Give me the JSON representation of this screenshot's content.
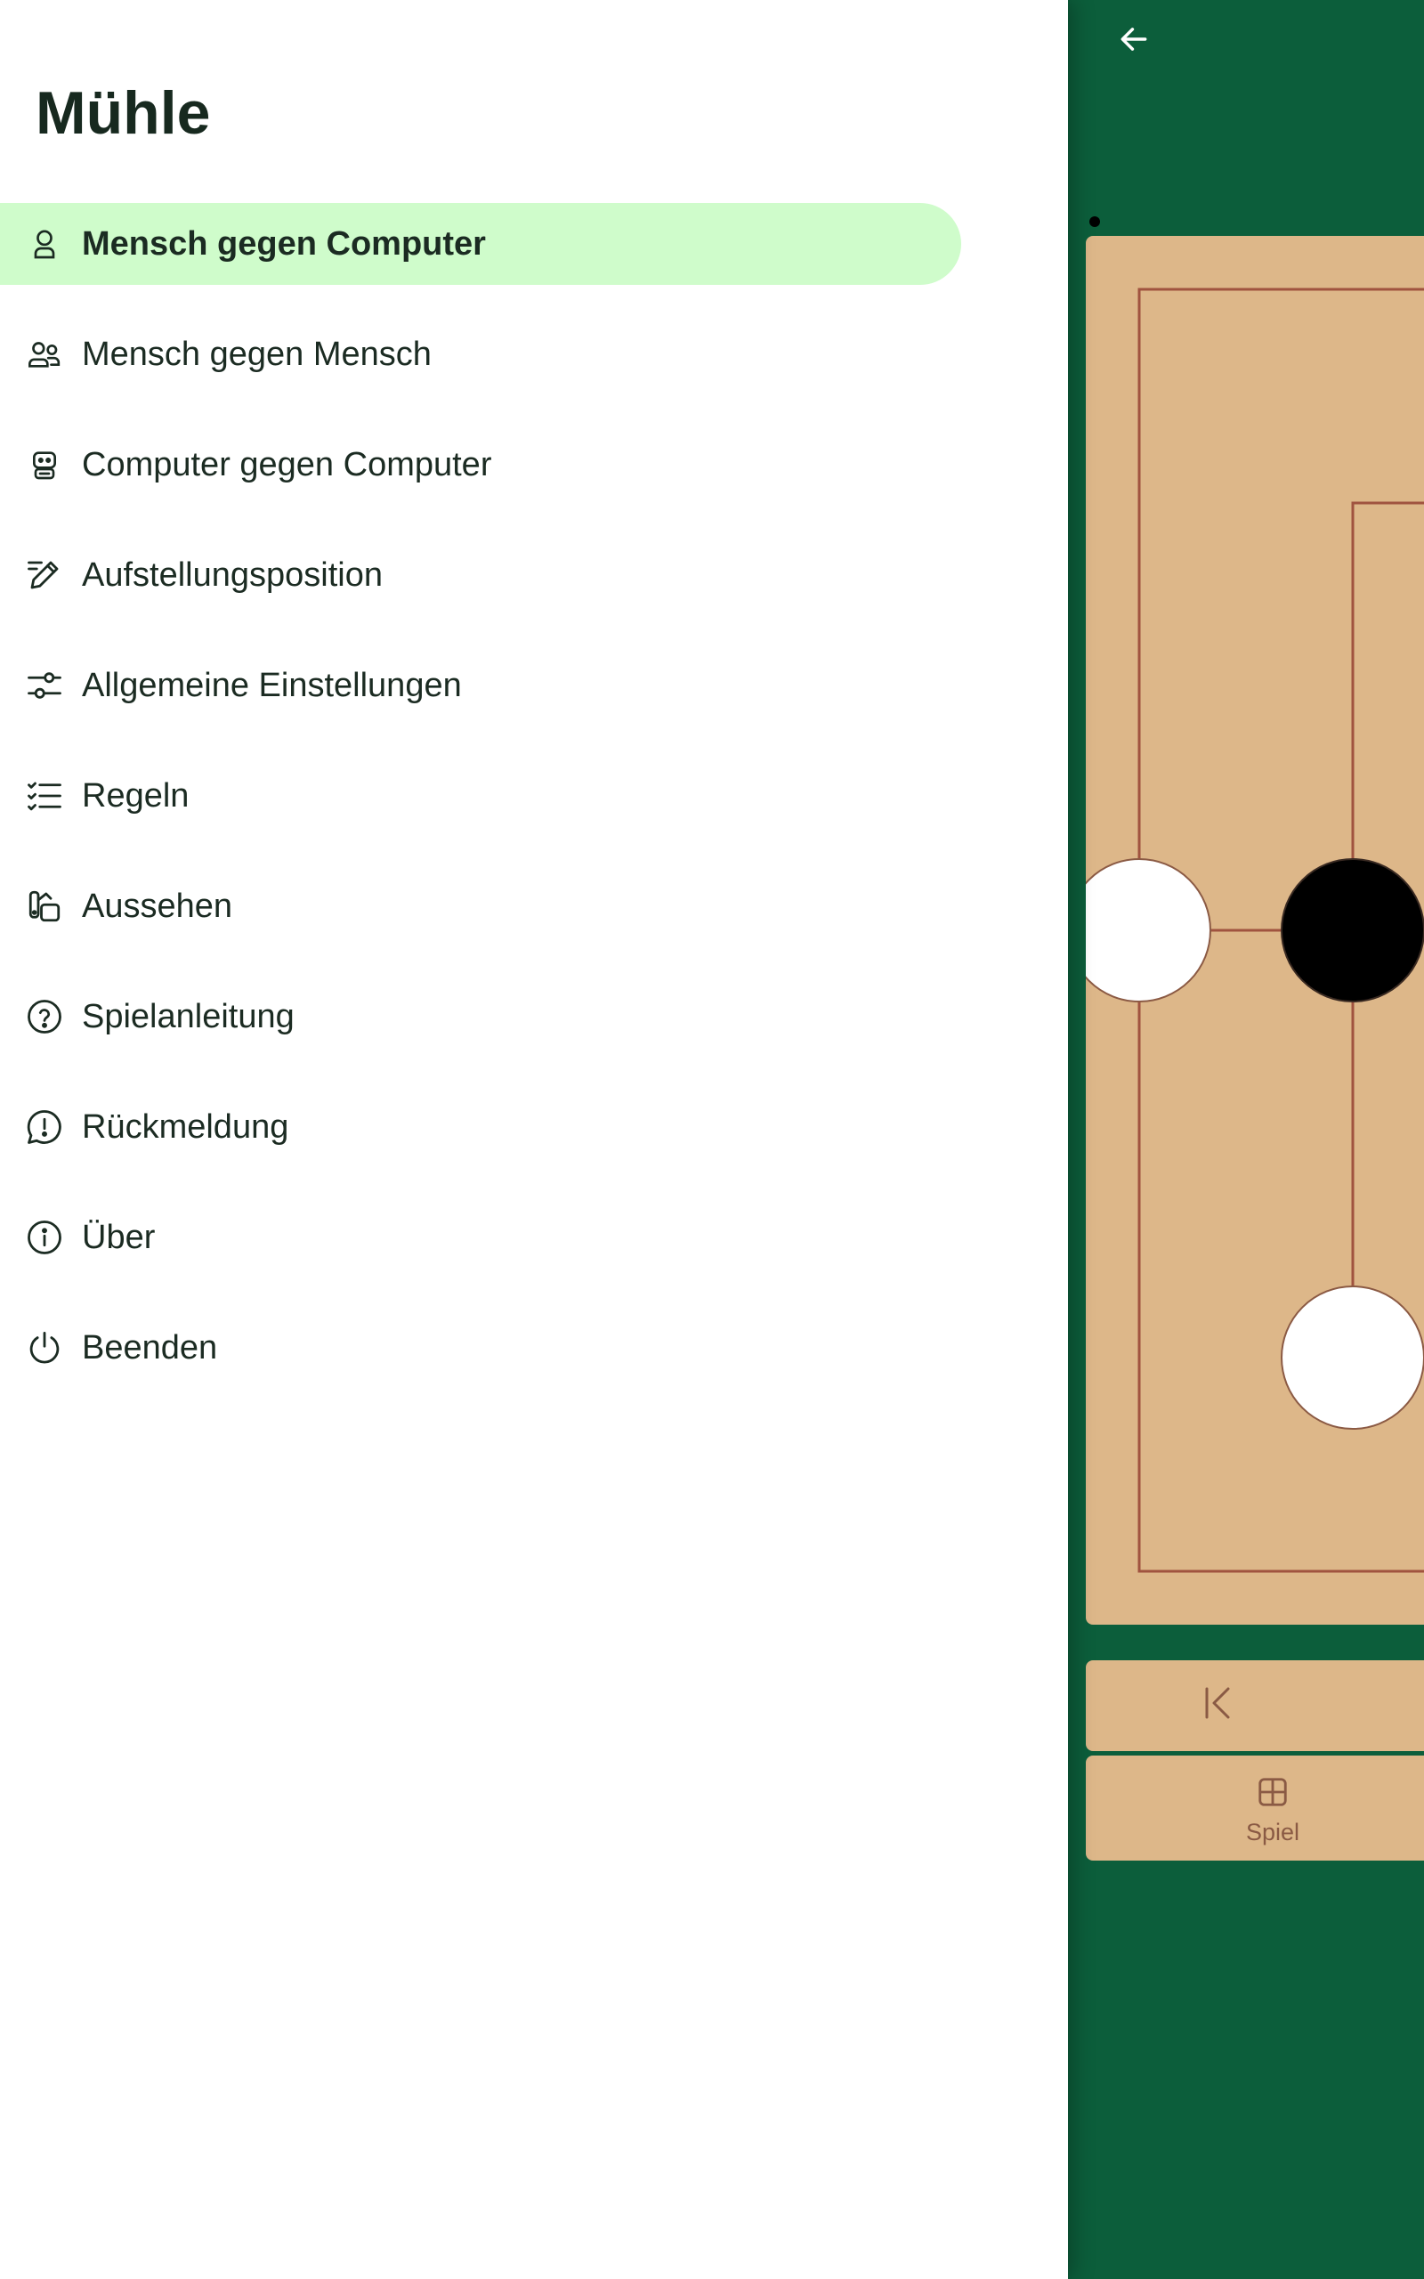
{
  "app": {
    "title": "Mühle"
  },
  "menu": {
    "items": [
      {
        "label": "Mensch gegen Computer",
        "icon": "person-icon",
        "active": true
      },
      {
        "label": "Mensch gegen Mensch",
        "icon": "people-icon",
        "active": false
      },
      {
        "label": "Computer gegen Computer",
        "icon": "robot-icon",
        "active": false
      },
      {
        "label": "Aufstellungsposition",
        "icon": "pencil-icon",
        "active": false
      },
      {
        "label": "Allgemeine Einstellungen",
        "icon": "sliders-icon",
        "active": false
      },
      {
        "label": "Regeln",
        "icon": "checklist-icon",
        "active": false
      },
      {
        "label": "Aussehen",
        "icon": "paint-icon",
        "active": false
      },
      {
        "label": "Spielanleitung",
        "icon": "help-icon",
        "active": false
      },
      {
        "label": "Rückmeldung",
        "icon": "feedback-icon",
        "active": false
      },
      {
        "label": "Über",
        "icon": "info-icon",
        "active": false
      },
      {
        "label": "Beenden",
        "icon": "power-icon",
        "active": false
      }
    ]
  },
  "game": {
    "nav_tab_label": "Spiel",
    "colors": {
      "background": "#0c5e3b",
      "board": "#ddb789",
      "lines": "#a0533f",
      "white_piece": "#ffffff",
      "black_piece": "#000000",
      "menu_active": "#cffccb"
    },
    "visible_pieces": [
      {
        "color": "white"
      },
      {
        "color": "black"
      },
      {
        "color": "white"
      }
    ]
  }
}
